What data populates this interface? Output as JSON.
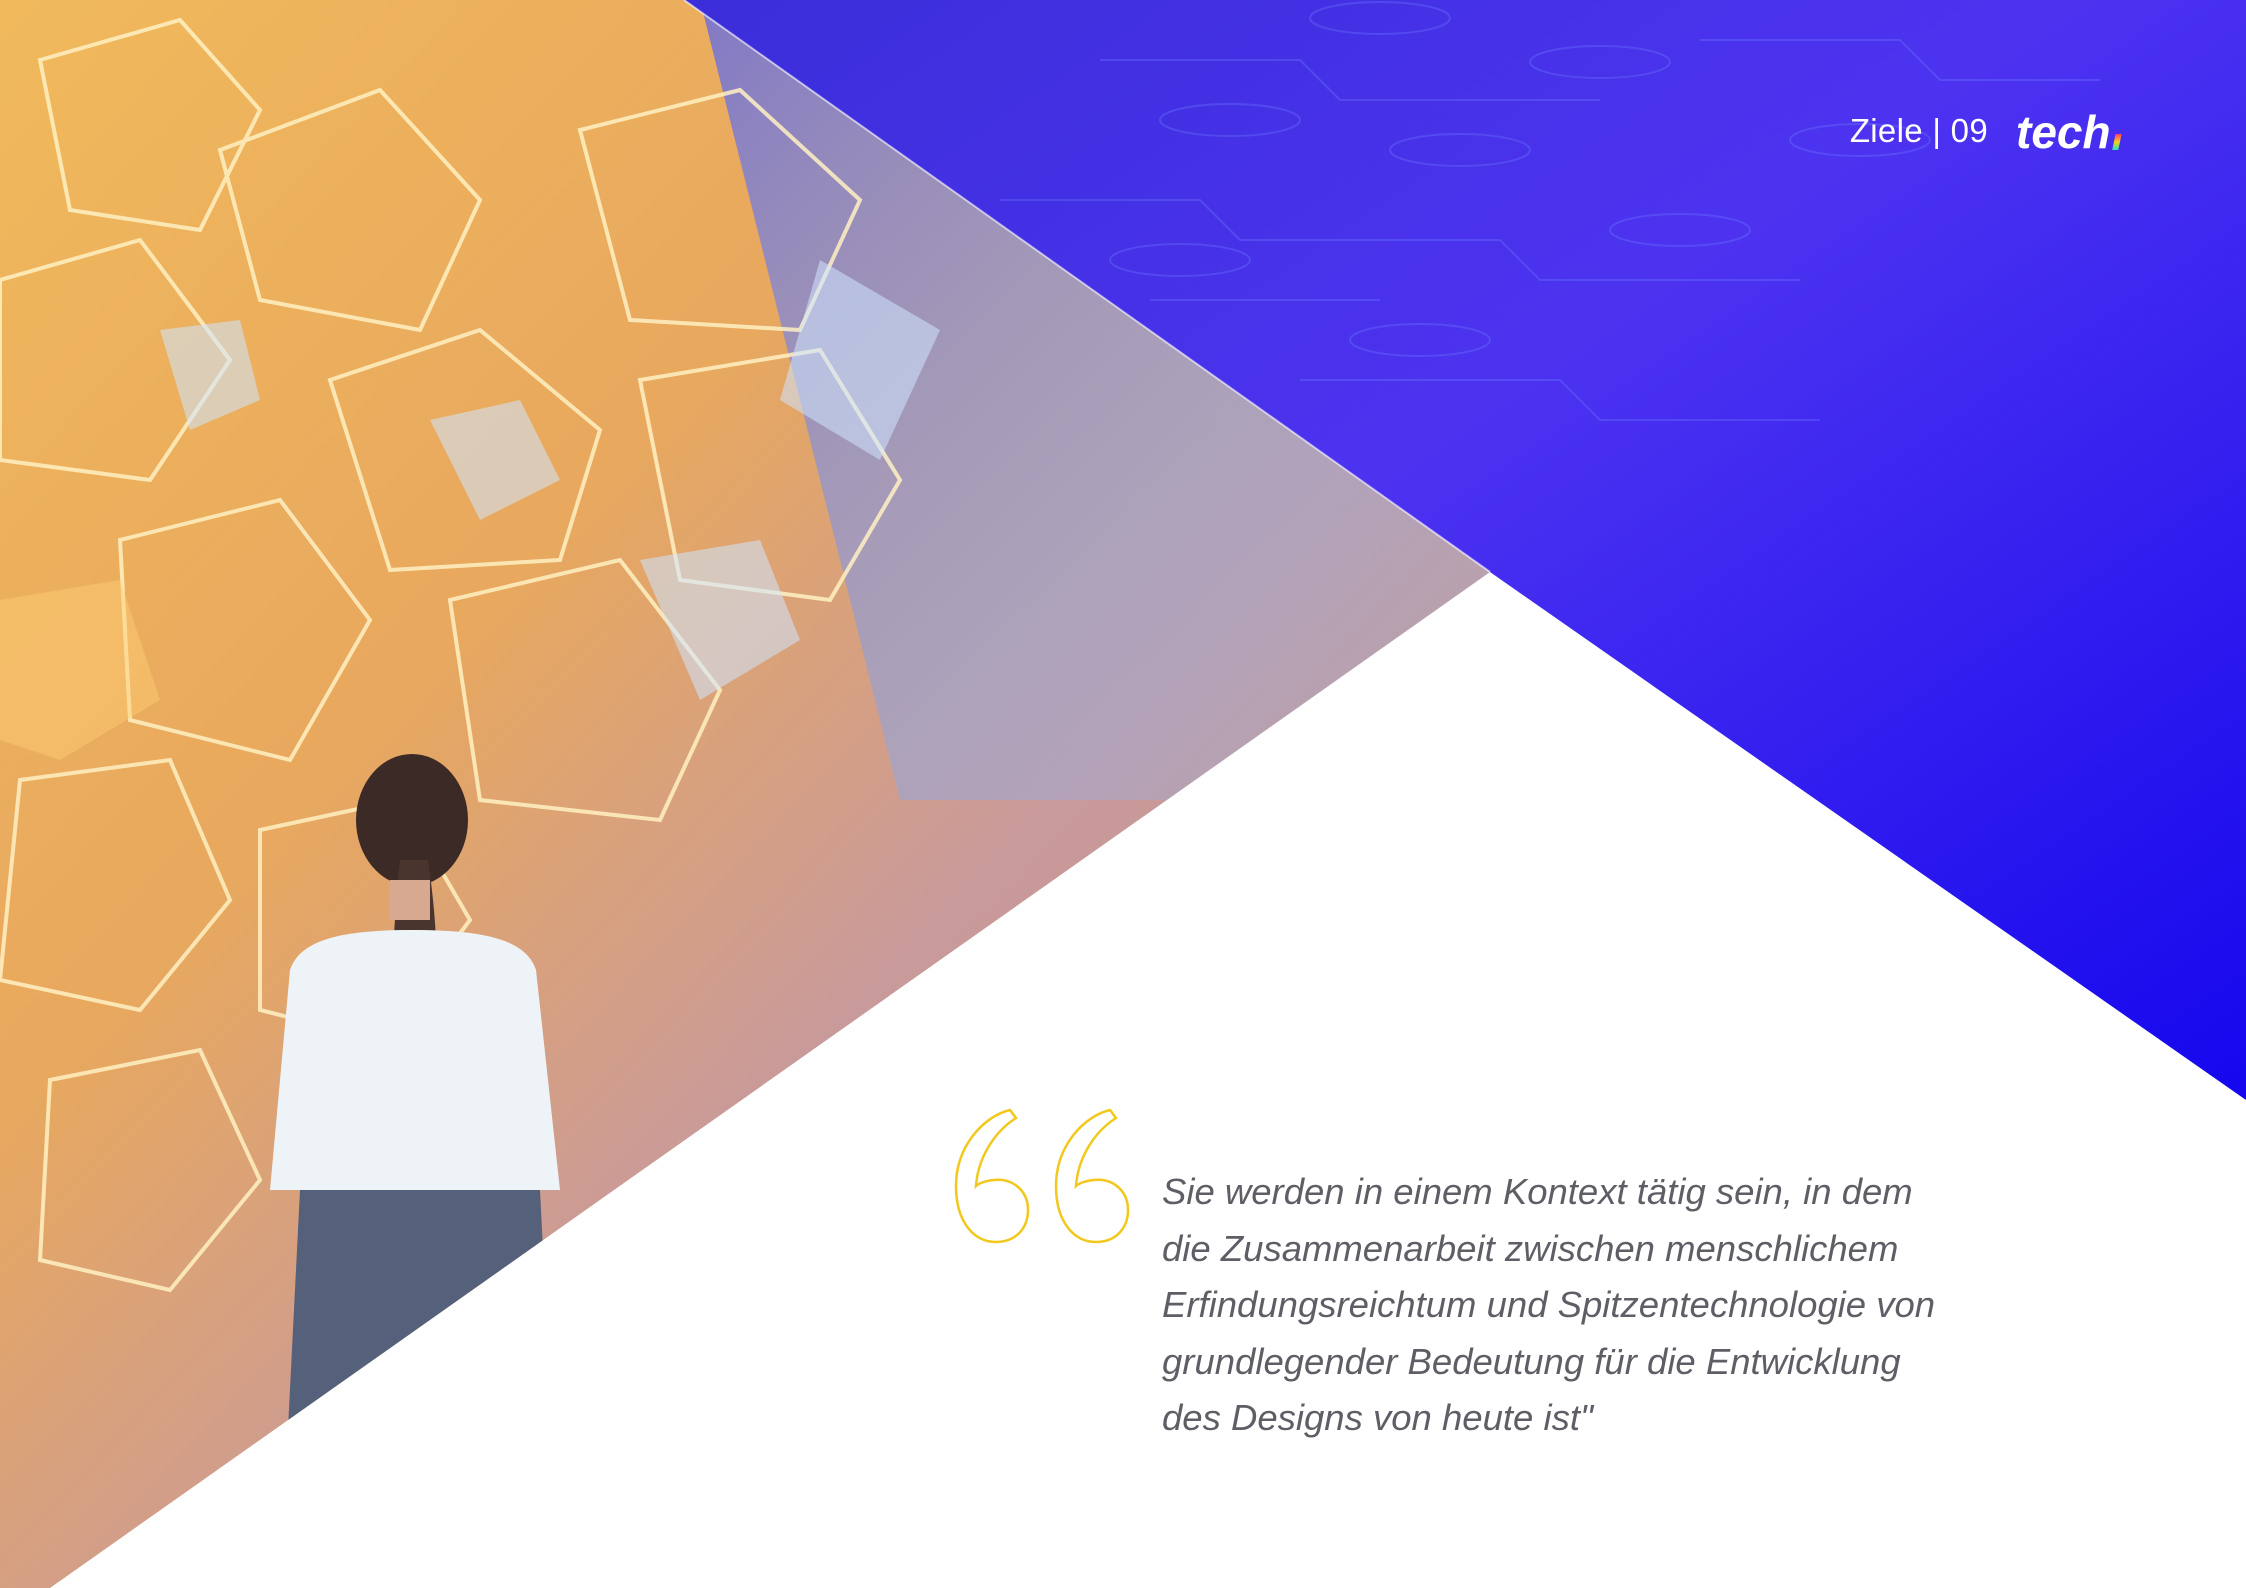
{
  "header": {
    "section_label": "Ziele | 09",
    "logo_text": "tech"
  },
  "hero_image": {
    "icon": "photo-woman-viewing-crystal-light-installation"
  },
  "quote": {
    "icon": "quotation-mark-icon",
    "text": "Sie werden in einem Kontext tätig sein, in dem die Zusammenarbeit zwischen menschlichem Erfindungsreichtum und Spitzentechnologie von grundlegender Bedeutung für die Entwicklung des Designs von heute ist\""
  },
  "colors": {
    "accent_blue": "#2a0fe6",
    "accent_violet": "#5a35f2",
    "quote_mark": "#f2c81c",
    "quote_text": "#5e5e66",
    "logo_highlight": "#1ee0c8"
  }
}
